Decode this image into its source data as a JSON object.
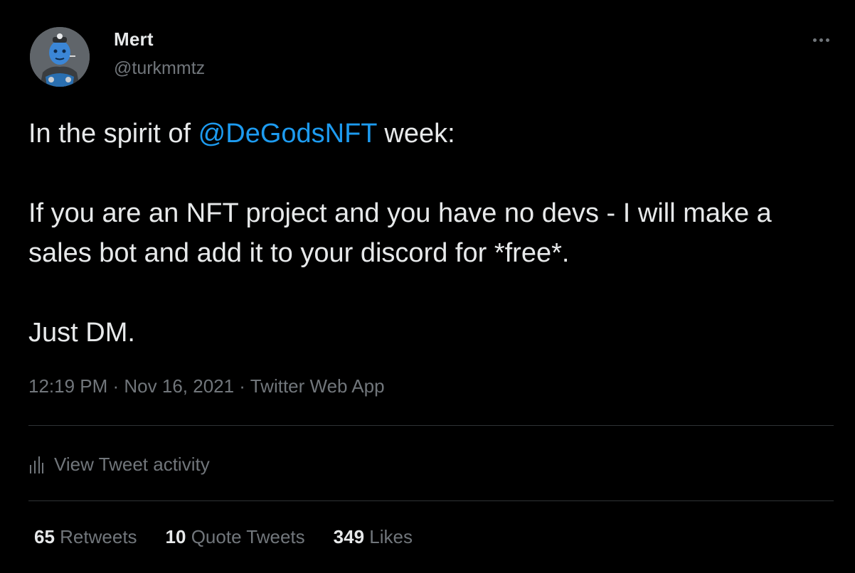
{
  "author": {
    "display_name": "Mert",
    "handle": "@turkmmtz"
  },
  "tweet": {
    "intro": "In the spirit of ",
    "mention": "@DeGodsNFT",
    "intro_end": " week:",
    "line2": "If you are an NFT project and you have no devs - I will make a sales bot and add it to your discord for *free*.",
    "line3": "Just DM."
  },
  "meta": {
    "time": "12:19 PM",
    "date": "Nov 16, 2021",
    "source": "Twitter Web App",
    "separator": " · "
  },
  "activity": {
    "label": "View Tweet activity",
    "icon": "bar-chart-icon"
  },
  "stats": {
    "retweets_count": "65",
    "retweets_label": "Retweets",
    "quotes_count": "10",
    "quotes_label": "Quote Tweets",
    "likes_count": "349",
    "likes_label": "Likes"
  },
  "colors": {
    "background": "#000000",
    "text": "#e7e9ea",
    "secondary": "#71767b",
    "link": "#1d9bf0",
    "divider": "#2f3336"
  }
}
